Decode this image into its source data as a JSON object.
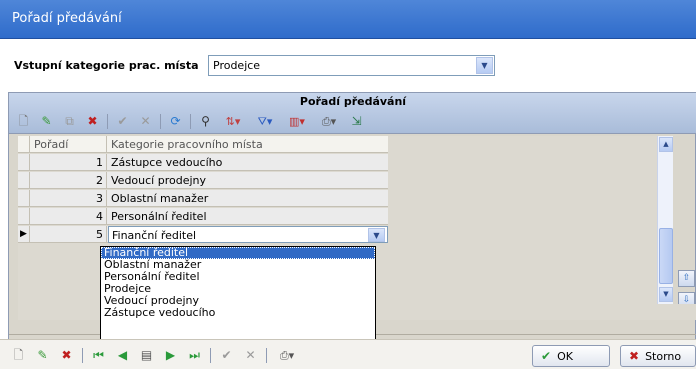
{
  "window": {
    "title": "Pořadí předávání"
  },
  "category": {
    "label": "Vstupní kategorie prac. místa",
    "value": "Prodejce"
  },
  "grid": {
    "caption": "Pořadí předávání",
    "columns": [
      "Pořadí",
      "Kategorie pracovního místa"
    ],
    "rows": [
      {
        "order": "1",
        "category": "Zástupce vedoucího"
      },
      {
        "order": "2",
        "category": "Vedoucí prodejny"
      },
      {
        "order": "3",
        "category": "Oblastní manažer"
      },
      {
        "order": "4",
        "category": "Personální ředitel"
      },
      {
        "order": "5",
        "category": "Finanční ředitel"
      }
    ]
  },
  "dropdown": {
    "options": [
      "Finanční ředitel",
      "Oblastní manažer",
      "Personální ředitel",
      "Prodejce",
      "Vedoucí prodejny",
      "Zástupce vedoucího"
    ],
    "selected": "Finanční ředitel"
  },
  "buttons": {
    "ok": "OK",
    "cancel": "Storno"
  },
  "colors": {
    "title_bar": "#3a76d2",
    "selection": "#316ac5",
    "panel": "#d9d6cc"
  }
}
